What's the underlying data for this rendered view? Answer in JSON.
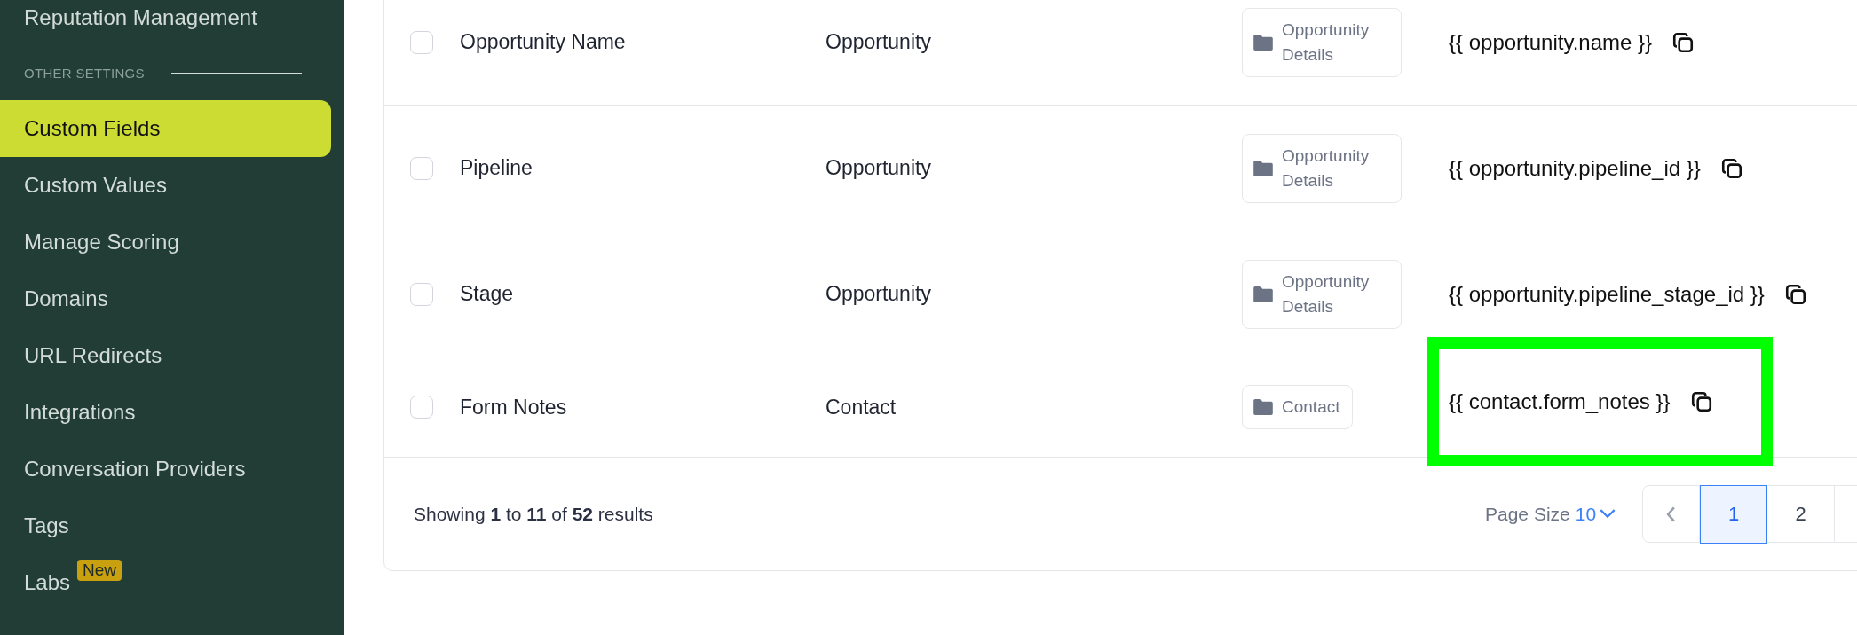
{
  "sidebar": {
    "items_before": [
      {
        "label": "Reputation Management",
        "selected": false
      }
    ],
    "section": "OTHER SETTINGS",
    "items": [
      {
        "label": "Custom Fields",
        "selected": true
      },
      {
        "label": "Custom Values",
        "selected": false
      },
      {
        "label": "Manage Scoring",
        "selected": false
      },
      {
        "label": "Domains",
        "selected": false
      },
      {
        "label": "URL Redirects",
        "selected": false
      },
      {
        "label": "Integrations",
        "selected": false
      },
      {
        "label": "Conversation Providers",
        "selected": false
      },
      {
        "label": "Tags",
        "selected": false
      },
      {
        "label": "Labs",
        "selected": false,
        "badge": "New"
      }
    ]
  },
  "table": {
    "rows": [
      {
        "checked": false,
        "name": "Opportunity Name",
        "object": "Opportunity",
        "folder": "Opportunity Details",
        "key": "{{ opportunity.name }}",
        "highlighted": false
      },
      {
        "checked": false,
        "name": "Pipeline",
        "object": "Opportunity",
        "folder": "Opportunity Details",
        "key": "{{ opportunity.pipeline_id }}",
        "highlighted": false
      },
      {
        "checked": false,
        "name": "Stage",
        "object": "Opportunity",
        "folder": "Opportunity Details",
        "key": "{{ opportunity.pipeline_stage_id }}",
        "highlighted": false
      },
      {
        "checked": false,
        "name": "Form Notes",
        "object": "Contact",
        "folder": "Contact",
        "key": "{{ contact.form_notes }}",
        "highlighted": true
      }
    ]
  },
  "footer": {
    "summary": "Showing **1** to **11** of **52** results",
    "page_size_label": "Page Size",
    "page_size": "10",
    "pages": [
      {
        "label": "1",
        "selected": true
      },
      {
        "label": "2",
        "selected": false
      }
    ]
  }
}
